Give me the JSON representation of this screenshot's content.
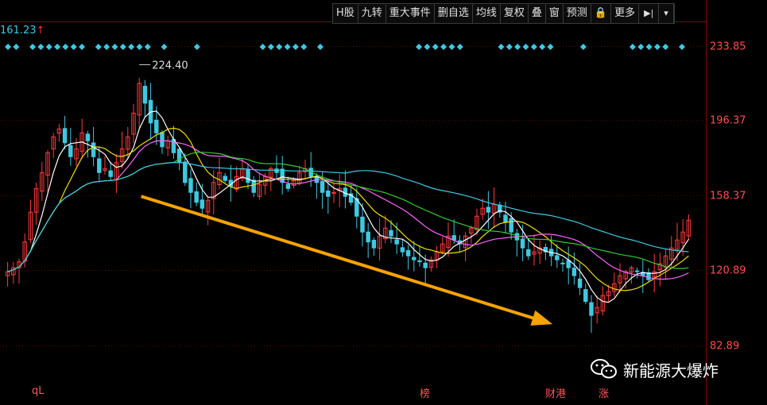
{
  "toolbar": {
    "items": [
      "H股",
      "九转",
      "重大事件",
      "删自选",
      "均线",
      "复权",
      "叠",
      "窗",
      "预测",
      "🔒",
      "更多",
      "▶|",
      "▾"
    ]
  },
  "header": {
    "current_price": "161.23",
    "arrow": "↑"
  },
  "watermark": {
    "text": "新能源大爆炸"
  },
  "bottom_marks": [
    "qL",
    "榜",
    "财港",
    "涨"
  ],
  "chart_data": {
    "type": "candlestick",
    "y_ticks": [
      233.85,
      196.37,
      158.37,
      120.89,
      82.89
    ],
    "ylim": [
      64,
      245
    ],
    "peak_annotation": "224.40",
    "peak_value": 224.4,
    "trend": {
      "from": [
        0.2,
        158
      ],
      "to": [
        0.77,
        95
      ],
      "color": "#f6a300"
    },
    "closes": [
      120,
      122,
      125,
      135,
      150,
      162,
      170,
      180,
      188,
      192,
      185,
      178,
      182,
      190,
      186,
      178,
      170,
      172,
      168,
      175,
      182,
      188,
      200,
      215,
      205,
      195,
      190,
      183,
      186,
      180,
      175,
      165,
      160,
      155,
      152,
      156,
      165,
      170,
      166,
      163,
      168,
      172,
      165,
      160,
      164,
      168,
      172,
      170,
      165,
      162,
      166,
      170,
      172,
      168,
      165,
      160,
      158,
      160,
      162,
      158,
      155,
      148,
      140,
      135,
      132,
      138,
      142,
      138,
      134,
      130,
      128,
      126,
      125,
      122,
      126,
      130,
      134,
      138,
      136,
      134,
      138,
      142,
      148,
      152,
      150,
      154,
      150,
      145,
      140,
      136,
      132,
      128,
      130,
      132,
      130,
      128,
      126,
      124,
      122,
      118,
      112,
      105,
      98,
      102,
      108,
      110,
      114,
      118,
      120,
      122,
      120,
      118,
      116,
      120,
      124,
      128,
      132,
      136,
      140,
      146
    ],
    "series": [
      {
        "name": "",
        "color": "#ffffff",
        "period": 5
      },
      {
        "name": "",
        "color": "#f0e000",
        "period": 10
      },
      {
        "name": "",
        "color": "#ff66ff",
        "period": 20
      },
      {
        "name": "",
        "color": "#33cc33",
        "period": 30
      },
      {
        "name": "",
        "color": "#3ec9e0",
        "period": 60
      }
    ],
    "colors": {
      "up": "#ff3b3b",
      "down": "#3ec9e0",
      "grid": "#5a0000",
      "axis": "#8b0000",
      "tick_label": "#ff4d4d",
      "marker": "#3ec9e0"
    }
  }
}
